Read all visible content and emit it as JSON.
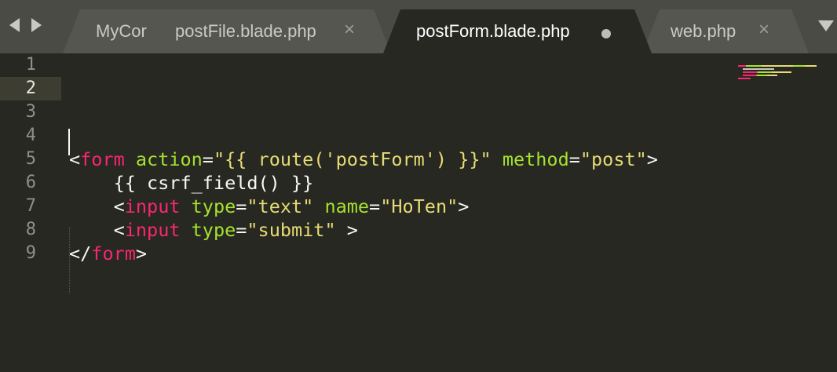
{
  "tabs": [
    {
      "title": "MyCor",
      "active": false
    },
    {
      "title": "postFile.blade.php",
      "close_glyph": "×",
      "active": false
    },
    {
      "title": "postForm.blade.php",
      "active": true,
      "dirty": true
    },
    {
      "title": "web.php",
      "close_glyph": "×",
      "active": false
    }
  ],
  "icons": {
    "nav_back": "chevron-left-icon",
    "nav_forward": "chevron-right-icon",
    "tab_menu": "chevron-down-icon",
    "unsaved": "dot-icon"
  },
  "colors": {
    "background": "#272822",
    "tabbar": "#4a4b45",
    "tag": "#f92672",
    "attribute": "#a6e22e",
    "string": "#e6db74",
    "text": "#f8f8f2",
    "current_line": "#3e3d32"
  },
  "editor": {
    "current_line": 2,
    "lines": [
      {
        "number": "1",
        "tokens": []
      },
      {
        "number": "2",
        "tokens": []
      },
      {
        "number": "3",
        "tokens": []
      },
      {
        "number": "4",
        "tokens": []
      },
      {
        "number": "5",
        "tokens": [
          {
            "t": "<",
            "c": "p"
          },
          {
            "t": "form",
            "c": "tg"
          },
          {
            "t": " ",
            "c": "p"
          },
          {
            "t": "action",
            "c": "at"
          },
          {
            "t": "=",
            "c": "p"
          },
          {
            "t": "\"{{ route('postForm') }}\"",
            "c": "st"
          },
          {
            "t": " ",
            "c": "p"
          },
          {
            "t": "method",
            "c": "at"
          },
          {
            "t": "=",
            "c": "p"
          },
          {
            "t": "\"post\"",
            "c": "st"
          },
          {
            "t": ">",
            "c": "p"
          }
        ]
      },
      {
        "number": "6",
        "tokens": [
          {
            "t": "    {{ csrf_field() }}",
            "c": "p"
          }
        ]
      },
      {
        "number": "7",
        "tokens": [
          {
            "t": "    <",
            "c": "p"
          },
          {
            "t": "input",
            "c": "tg"
          },
          {
            "t": " ",
            "c": "p"
          },
          {
            "t": "type",
            "c": "at"
          },
          {
            "t": "=",
            "c": "p"
          },
          {
            "t": "\"text\"",
            "c": "st"
          },
          {
            "t": " ",
            "c": "p"
          },
          {
            "t": "name",
            "c": "at"
          },
          {
            "t": "=",
            "c": "p"
          },
          {
            "t": "\"HoTen\"",
            "c": "st"
          },
          {
            "t": ">",
            "c": "p"
          }
        ]
      },
      {
        "number": "8",
        "tokens": [
          {
            "t": "    <",
            "c": "p"
          },
          {
            "t": "input",
            "c": "tg"
          },
          {
            "t": " ",
            "c": "p"
          },
          {
            "t": "type",
            "c": "at"
          },
          {
            "t": "=",
            "c": "p"
          },
          {
            "t": "\"submit\"",
            "c": "st"
          },
          {
            "t": " >",
            "c": "p"
          }
        ]
      },
      {
        "number": "9",
        "tokens": [
          {
            "t": "</",
            "c": "p"
          },
          {
            "t": "form",
            "c": "tg"
          },
          {
            "t": ">",
            "c": "p"
          }
        ]
      }
    ]
  }
}
